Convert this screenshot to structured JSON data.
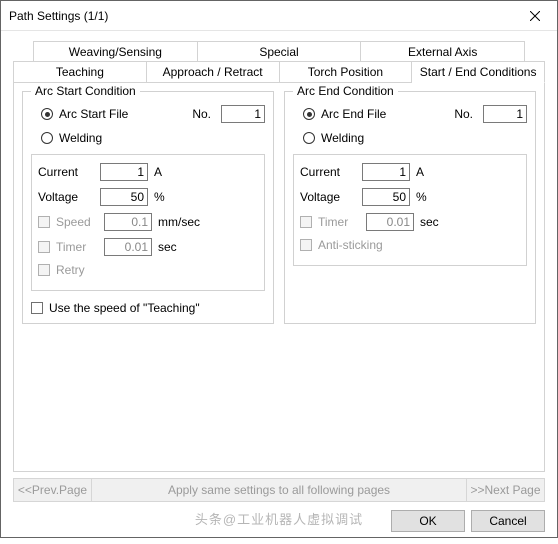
{
  "window": {
    "title": "Path Settings  (1/1)"
  },
  "tabs_row1": {
    "weaving": "Weaving/Sensing",
    "special": "Special",
    "external": "External Axis"
  },
  "tabs_row2": {
    "teaching": "Teaching",
    "approach": "Approach / Retract",
    "torch": "Torch Position",
    "startend": "Start / End Conditions"
  },
  "arc_start": {
    "legend": "Arc Start Condition",
    "file_label": "Arc Start File",
    "no_label": "No.",
    "no_val": "1",
    "welding_label": "Welding",
    "current_label": "Current",
    "current_val": "1",
    "current_unit": "A",
    "voltage_label": "Voltage",
    "voltage_val": "50",
    "voltage_unit": "%",
    "speed_label": "Speed",
    "speed_val": "0.1",
    "speed_unit": "mm/sec",
    "timer_label": "Timer",
    "timer_val": "0.01",
    "timer_unit": "sec",
    "retry_label": "Retry"
  },
  "arc_end": {
    "legend": "Arc End Condition",
    "file_label": "Arc End File",
    "no_label": "No.",
    "no_val": "1",
    "welding_label": "Welding",
    "current_label": "Current",
    "current_val": "1",
    "current_unit": "A",
    "voltage_label": "Voltage",
    "voltage_val": "50",
    "voltage_unit": "%",
    "timer_label": "Timer",
    "timer_val": "0.01",
    "timer_unit": "sec",
    "antistick_label": "Anti-sticking"
  },
  "use_speed": "Use the speed of \"Teaching\"",
  "nav": {
    "prev": "<<Prev.Page",
    "apply": "Apply same settings to all following pages",
    "next": ">>Next Page"
  },
  "buttons": {
    "ok": "OK",
    "cancel": "Cancel"
  },
  "watermark": "头条@工业机器人虚拟调试"
}
